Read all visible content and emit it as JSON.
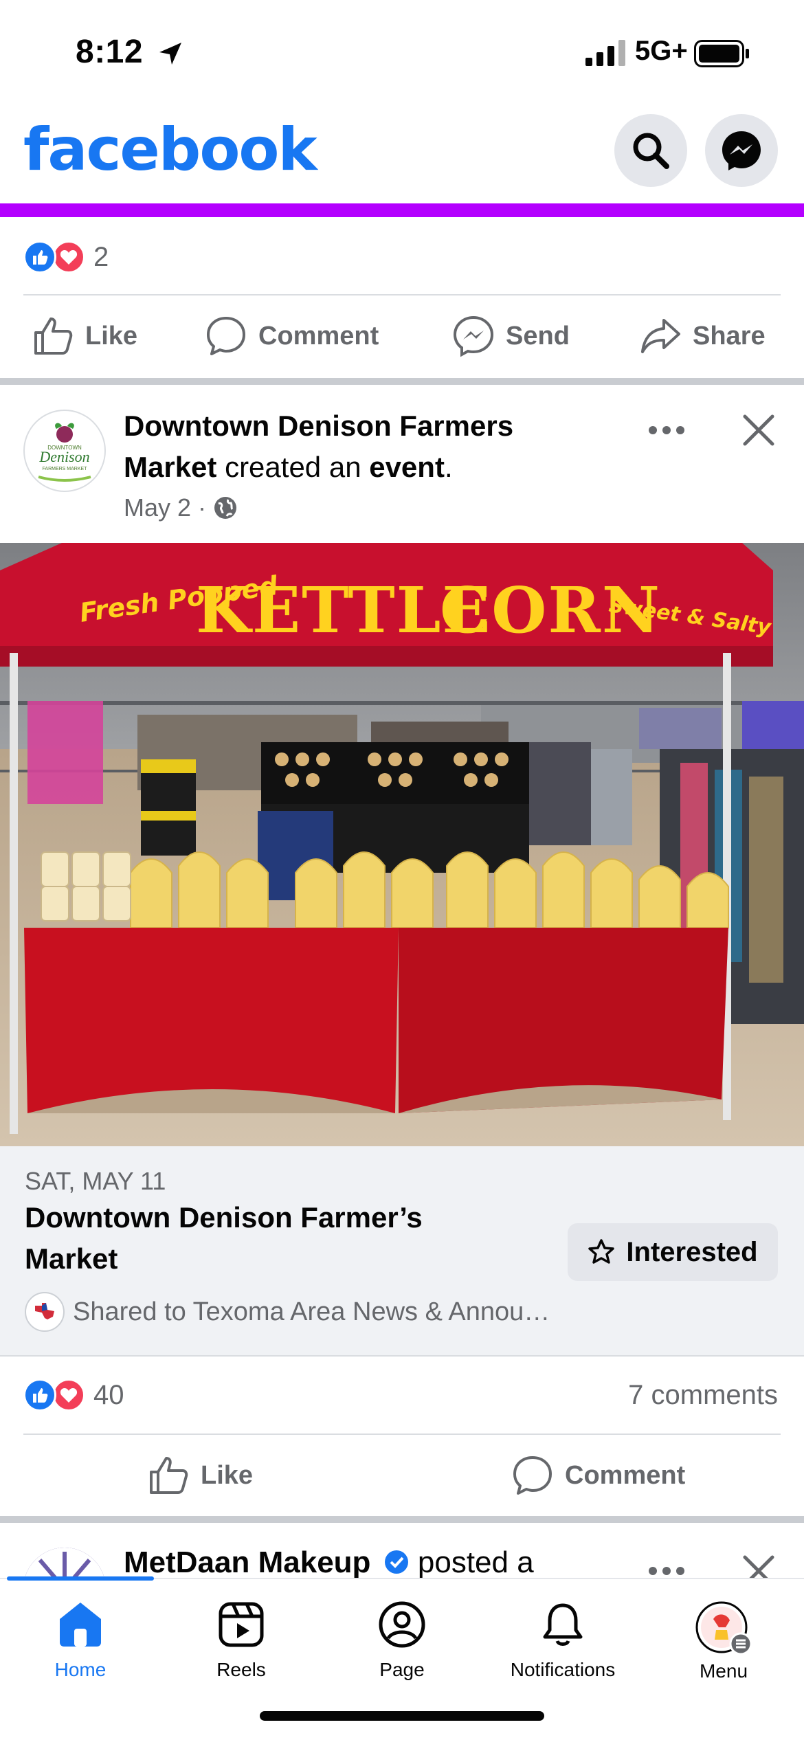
{
  "status_bar": {
    "time": "8:12",
    "network": "5G+"
  },
  "header": {
    "logo": "facebook",
    "search_icon": "search-icon",
    "messenger_icon": "messenger-icon"
  },
  "prev_post": {
    "reaction_count": "2",
    "actions": {
      "like": "Like",
      "comment": "Comment",
      "send": "Send",
      "share": "Share"
    }
  },
  "post": {
    "page_name_line1": "Downtown Denison Farmers",
    "page_name_line2": "Market",
    "verb1": " created an ",
    "object": "event",
    "period": ".",
    "date": "May 2",
    "separator": "·",
    "avatar_text": {
      "top": "DOWNTOWN",
      "script": "Denison",
      "bottom": "FARMERS MARKET"
    },
    "image_text": {
      "left": "Fresh Popped",
      "main1": "KETTLE",
      "main2": "CORN",
      "right": "Sweet & Salty"
    },
    "event": {
      "date": "SAT, MAY 11",
      "title_line1": "Downtown Denison Farmer’s",
      "title_line2": "Market",
      "interested_label": "Interested",
      "shared_text": "Shared to Texoma Area News & Annou…"
    },
    "reaction_count": "40",
    "comments": "7 comments",
    "actions": {
      "like": "Like",
      "comment": "Comment"
    }
  },
  "next_post": {
    "name": "MetDaan Makeup",
    "verb": " posted a"
  },
  "tabs": [
    {
      "label": "Home",
      "icon": "home-icon"
    },
    {
      "label": "Reels",
      "icon": "reels-icon"
    },
    {
      "label": "Page",
      "icon": "page-icon"
    },
    {
      "label": "Notifications",
      "icon": "bell-icon"
    },
    {
      "label": "Menu",
      "icon": "menu-avatar-icon"
    }
  ],
  "colors": {
    "brand": "#1877f2",
    "accent_bar": "#b400ff",
    "love": "#f33e58",
    "tent": "#c8102e"
  }
}
